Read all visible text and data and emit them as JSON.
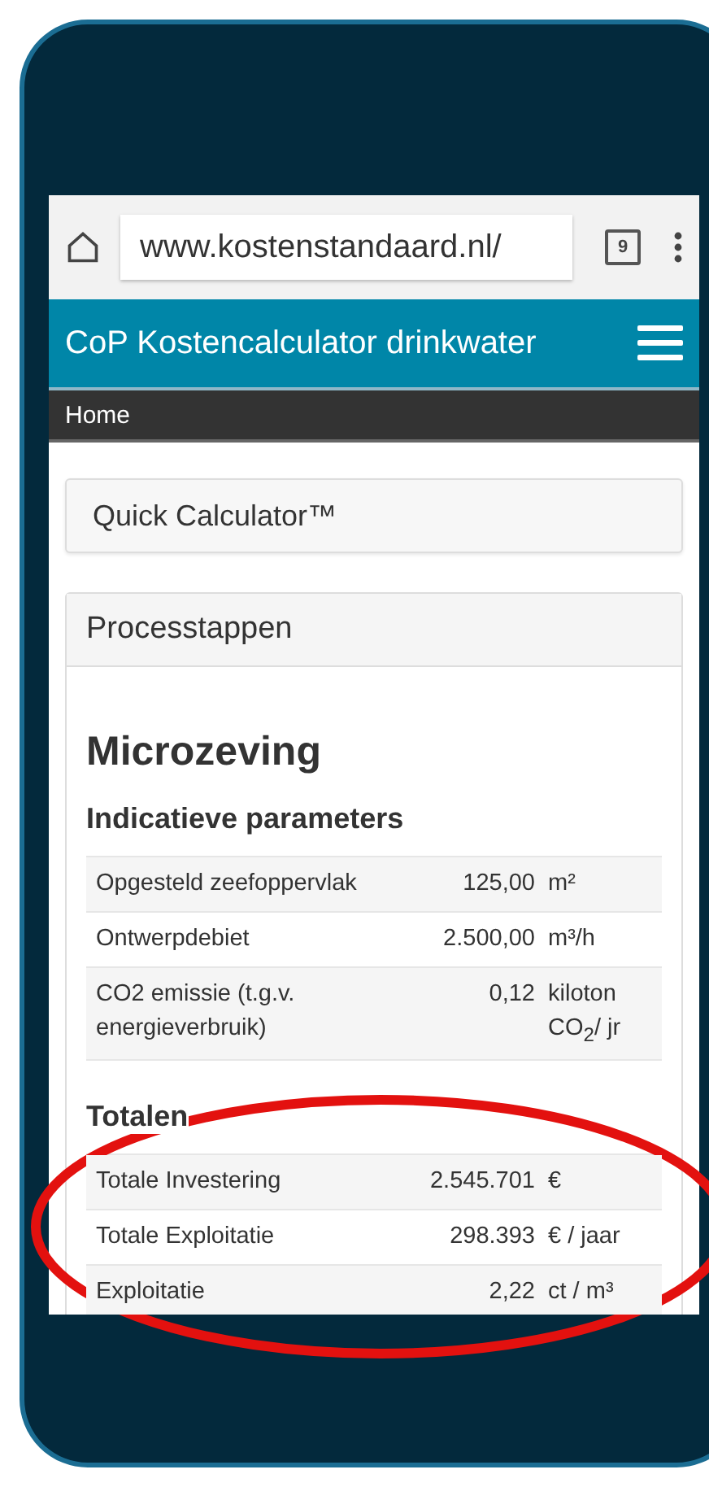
{
  "browser": {
    "url": "www.kostenstandaard.nl/",
    "tab_count": "9"
  },
  "app_bar": {
    "title": "CoP Kostencalculator drinkwater"
  },
  "breadcrumb": {
    "label": "Home"
  },
  "quick_calculator": {
    "label": "Quick Calculator™"
  },
  "panel": {
    "title": "Processtappen",
    "heading": "Microzeving",
    "sections": [
      {
        "title": "Indicatieve parameters",
        "rows": [
          {
            "label": "Opgesteld zeefoppervlak",
            "value": "125,00",
            "unit": "m²"
          },
          {
            "label": "Ontwerpdebiet",
            "value": "2.500,00",
            "unit": "m³/h"
          },
          {
            "label": "CO2 emissie (t.g.v. energieverbruik)",
            "value": "0,12",
            "unit": "kiloton CO$_{2}$/ jr"
          }
        ]
      },
      {
        "title": "Totalen",
        "rows": [
          {
            "label": "Totale Investering",
            "value": "2.545.701",
            "unit": "€"
          },
          {
            "label": "Totale Exploitatie",
            "value": "298.393",
            "unit": "€ / jaar"
          },
          {
            "label": "Exploitatie",
            "value": "2,22",
            "unit": "ct / m³"
          }
        ]
      }
    ]
  }
}
